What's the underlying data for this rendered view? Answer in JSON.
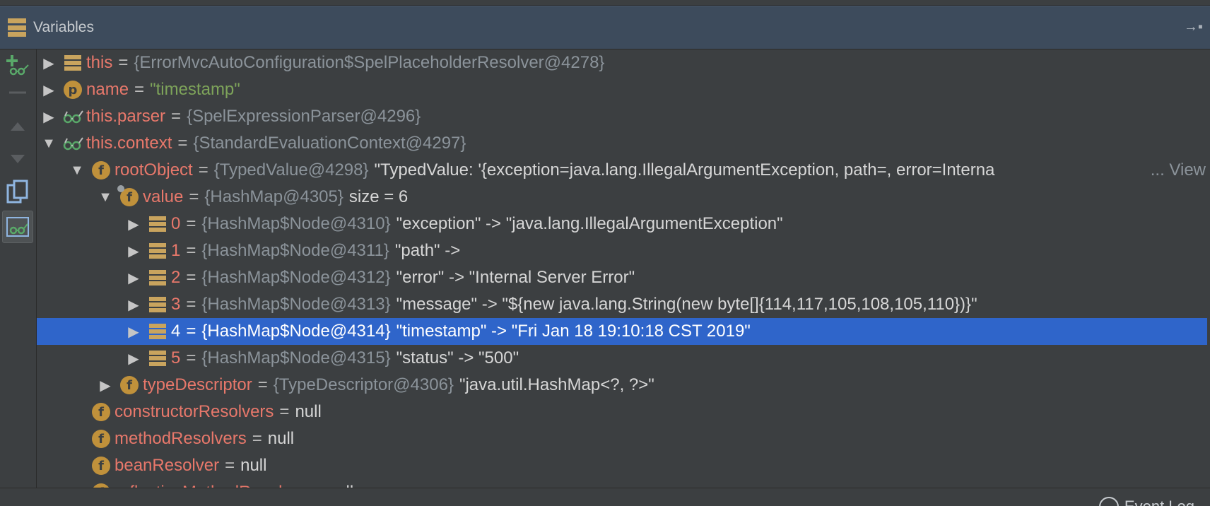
{
  "panel": {
    "title": "Variables",
    "pin_glyph": "→▪"
  },
  "toolbar": {
    "buttons": [
      {
        "name": "add-watch-button",
        "icon": "add-watch-icon"
      },
      {
        "name": "remove-watch-button",
        "icon": "minus-icon"
      },
      {
        "name": "move-up-button",
        "icon": "up-triangle-icon"
      },
      {
        "name": "move-down-button",
        "icon": "down-triangle-icon"
      },
      {
        "name": "copy-button",
        "icon": "copy-icon"
      },
      {
        "name": "show-watches-button",
        "icon": "watches-icon"
      }
    ]
  },
  "rows": [
    {
      "name": "this",
      "obj": "{ErrorMvcAutoConfiguration$SpelPlaceholderResolver@4278}",
      "val": ""
    },
    {
      "name": "name",
      "str": "\"timestamp\""
    },
    {
      "name": "this.parser",
      "obj": "{SpelExpressionParser@4296}"
    },
    {
      "name": "this.context",
      "obj": "{StandardEvaluationContext@4297}"
    },
    {
      "name": "rootObject",
      "obj": "{TypedValue@4298}",
      "val": "\"TypedValue: '{exception=java.lang.IllegalArgumentException, path=, error=Interna",
      "view": "... View"
    },
    {
      "name": "value",
      "obj": "{HashMap@4305}",
      "val": " size = 6"
    },
    {
      "name": "0",
      "obj": "{HashMap$Node@4310}",
      "val": "\"exception\" -> \"java.lang.IllegalArgumentException\""
    },
    {
      "name": "1",
      "obj": "{HashMap$Node@4311}",
      "val": "\"path\" ->"
    },
    {
      "name": "2",
      "obj": "{HashMap$Node@4312}",
      "val": "\"error\" -> \"Internal Server Error\""
    },
    {
      "name": "3",
      "obj": "{HashMap$Node@4313}",
      "val": "\"message\" -> \"${new java.lang.String(new byte[]{114,117,105,108,105,110})}\""
    },
    {
      "name": "4",
      "obj": "{HashMap$Node@4314}",
      "val": "\"timestamp\" -> \"Fri Jan 18 19:10:18 CST 2019\""
    },
    {
      "name": "5",
      "obj": "{HashMap$Node@4315}",
      "val": "\"status\" -> \"500\""
    },
    {
      "name": "typeDescriptor",
      "obj": "{TypeDescriptor@4306}",
      "val": "\"java.util.HashMap<?, ?>\""
    },
    {
      "name": "constructorResolvers",
      "val": "null"
    },
    {
      "name": "methodResolvers",
      "val": "null"
    },
    {
      "name": "beanResolver",
      "val": "null"
    },
    {
      "name": "reflectiveMethodResolver",
      "val": "null"
    }
  ],
  "badges": {
    "p": "p",
    "f": "f"
  },
  "eq": "=",
  "status_bar": {
    "event_log": "Event Log"
  },
  "colors": {
    "selection": "#2f65ca",
    "var_name": "#e8786b",
    "string": "#7ea45a",
    "field_badge": "#c0913b"
  }
}
